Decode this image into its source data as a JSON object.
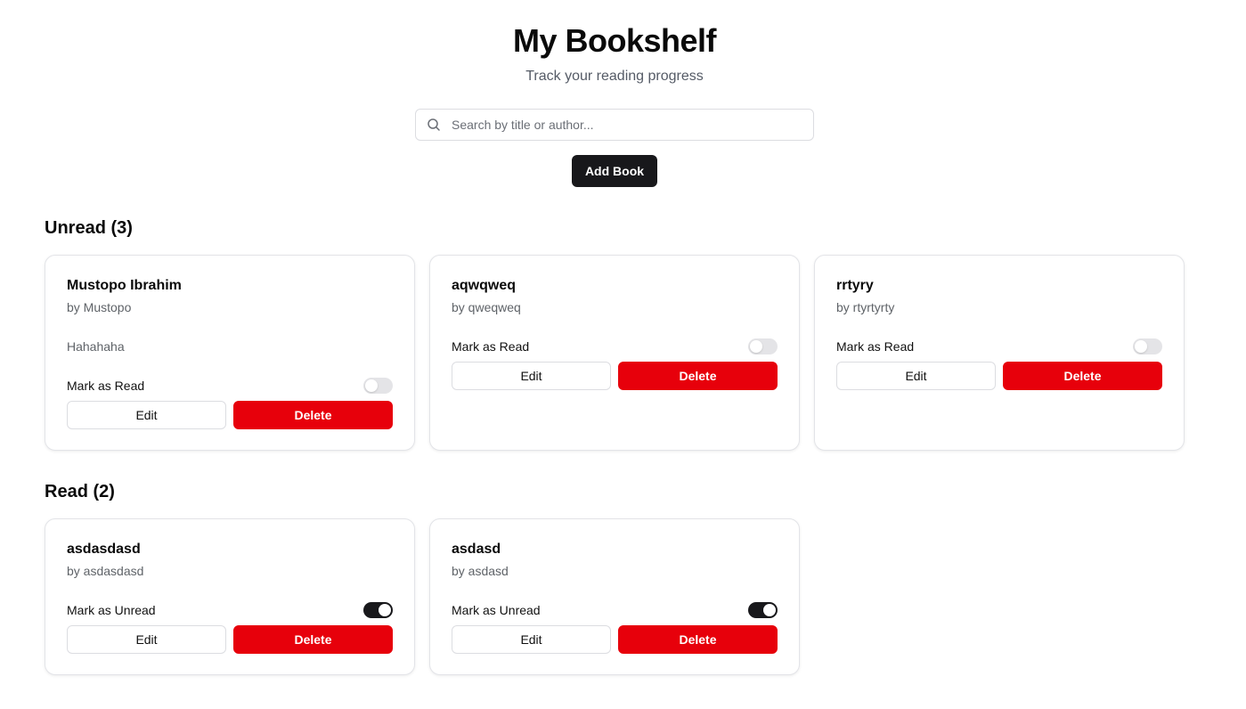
{
  "header": {
    "title": "My Bookshelf",
    "subtitle": "Track your reading progress"
  },
  "search": {
    "placeholder": "Search by title or author...",
    "value": "",
    "icon": "search-icon"
  },
  "actions": {
    "add_label": "Add Book"
  },
  "sections": {
    "unread": {
      "heading": "Unread (3)",
      "books": [
        {
          "title": "Mustopo Ibrahim",
          "author": "by Mustopo",
          "description": "Hahahaha",
          "toggle_label": "Mark as Read",
          "is_read": false,
          "edit_label": "Edit",
          "delete_label": "Delete"
        },
        {
          "title": "aqwqweq",
          "author": "by qweqweq",
          "toggle_label": "Mark as Read",
          "is_read": false,
          "edit_label": "Edit",
          "delete_label": "Delete"
        },
        {
          "title": "rrtyry",
          "author": "by rtyrtyrty",
          "toggle_label": "Mark as Read",
          "is_read": false,
          "edit_label": "Edit",
          "delete_label": "Delete"
        }
      ]
    },
    "read": {
      "heading": "Read (2)",
      "books": [
        {
          "title": "asdasdasd",
          "author": "by asdasdasd",
          "toggle_label": "Mark as Unread",
          "is_read": true,
          "edit_label": "Edit",
          "delete_label": "Delete"
        },
        {
          "title": "asdasd",
          "author": "by asdasd",
          "toggle_label": "Mark as Unread",
          "is_read": true,
          "edit_label": "Edit",
          "delete_label": "Delete"
        }
      ]
    }
  },
  "colors": {
    "primary": "#18181b",
    "danger": "#e7000b",
    "muted_text": "#5f6368",
    "border": "#e3e4e8"
  }
}
